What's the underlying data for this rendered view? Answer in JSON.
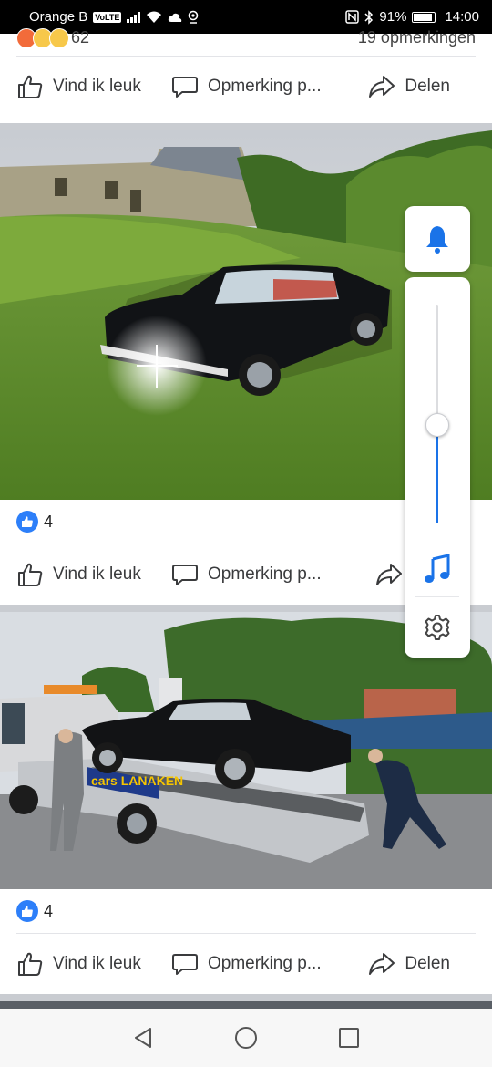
{
  "status_bar": {
    "carrier": "Orange B",
    "volte": "VoLTE",
    "battery_percent": "91%",
    "time": "14:00",
    "battery_level": 0.91
  },
  "post_top": {
    "reaction_count": "62",
    "comment_count": "19 opmerkingen",
    "like_label": "Vind ik leuk",
    "comment_label": "Opmerking p...",
    "share_label": "Delen"
  },
  "post_mustang": {
    "like_count": "4",
    "like_label": "Vind ik leuk",
    "comment_label": "Opmerking p...",
    "share_label": "Delen"
  },
  "post_truck": {
    "truck_logo": "cars LANAKEN",
    "like_count": "4",
    "like_label": "Vind ik leuk",
    "comment_label": "Opmerking p...",
    "share_label": "Delen"
  },
  "volume_panel": {
    "level": 0.45,
    "accent": "#1a73e8",
    "icons": [
      "bell-icon",
      "music-note-icon",
      "gear-icon"
    ]
  },
  "colors": {
    "like_blue": "#2d7ff9",
    "text": "#3a3b3d"
  }
}
